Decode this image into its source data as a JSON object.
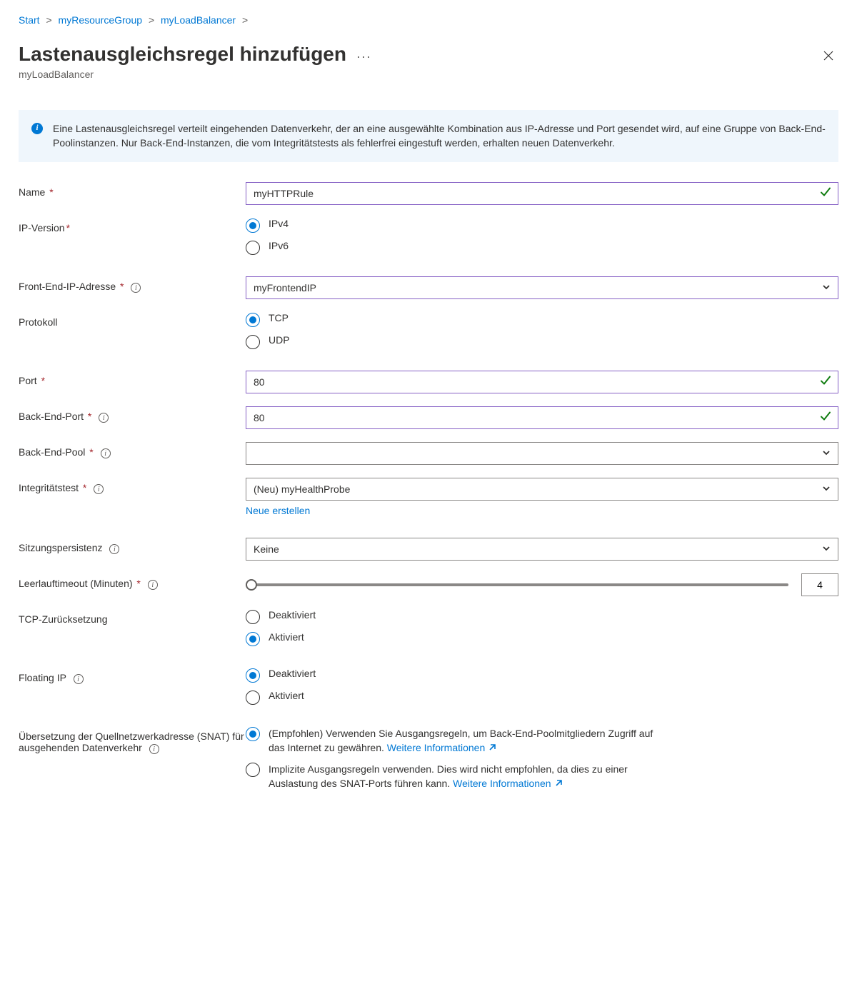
{
  "breadcrumb": {
    "items": [
      "Start",
      "myResourceGroup",
      "myLoadBalancer"
    ]
  },
  "header": {
    "title": "Lastenausgleichsregel hinzufügen",
    "subtitle": "myLoadBalancer",
    "more_symbol": "···"
  },
  "infobox": {
    "text": "Eine Lastenausgleichsregel verteilt eingehenden Datenverkehr, der an eine ausgewählte Kombination aus IP-Adresse und Port gesendet wird, auf eine Gruppe von Back-End-Poolinstanzen. Nur Back-End-Instanzen, die vom Integritätstests als fehlerfrei eingestuft werden, erhalten neuen Datenverkehr."
  },
  "form": {
    "name": {
      "label": "Name",
      "value": "myHTTPRule",
      "required": true
    },
    "ip_version": {
      "label": "IP-Version",
      "required": true,
      "options": [
        "IPv4",
        "IPv6"
      ],
      "selected": "IPv4"
    },
    "frontend_ip": {
      "label": "Front-End-IP-Adresse",
      "required": true,
      "info": true,
      "value": "myFrontendIP"
    },
    "protocol": {
      "label": "Protokoll",
      "options": [
        "TCP",
        "UDP"
      ],
      "selected": "TCP"
    },
    "port": {
      "label": "Port",
      "required": true,
      "value": "80"
    },
    "backend_port": {
      "label": "Back-End-Port",
      "required": true,
      "info": true,
      "value": "80"
    },
    "backend_pool": {
      "label": "Back-End-Pool",
      "required": true,
      "info": true,
      "value": ""
    },
    "health_probe": {
      "label": "Integritätstest",
      "required": true,
      "info": true,
      "value": "(Neu) myHealthProbe",
      "create_link": "Neue erstellen"
    },
    "session_persistence": {
      "label": "Sitzungspersistenz",
      "info": true,
      "value": "Keine"
    },
    "idle_timeout": {
      "label": "Leerlauftimeout (Minuten)",
      "required": true,
      "info": true,
      "value": "4"
    },
    "tcp_reset": {
      "label": "TCP-Zurücksetzung",
      "options": [
        "Deaktiviert",
        "Aktiviert"
      ],
      "selected": "Aktiviert"
    },
    "floating_ip": {
      "label": "Floating IP",
      "info": true,
      "options": [
        "Deaktiviert",
        "Aktiviert"
      ],
      "selected": "Deaktiviert"
    },
    "snat": {
      "label": "Übersetzung der Quellnetzwerkadresse (SNAT) für ausgehenden Datenverkehr",
      "info": true,
      "options": [
        {
          "text": "(Empfohlen) Verwenden Sie Ausgangsregeln, um Back-End-Poolmitgliedern Zugriff auf das Internet zu gewähren. ",
          "link": "Weitere Informationen",
          "selected": true
        },
        {
          "text": "Implizite Ausgangsregeln verwenden. Dies wird nicht empfohlen, da dies zu einer Auslastung des SNAT-Ports führen kann. ",
          "link": "Weitere Informationen",
          "selected": false
        }
      ]
    }
  }
}
